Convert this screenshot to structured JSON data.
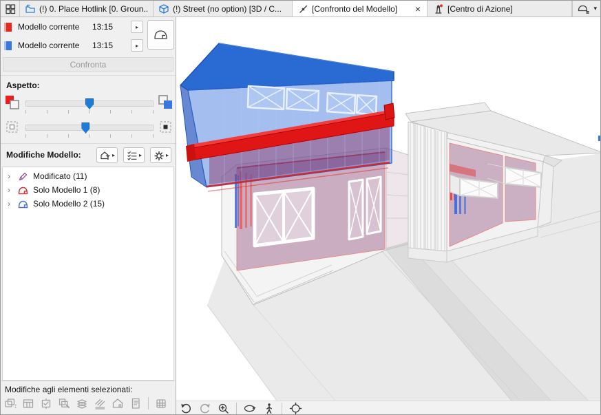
{
  "tab_bar": {
    "overview_button": {
      "icon": "tab-overview-icon"
    },
    "tabs": [
      {
        "label": "(!) 0. Place Hotlink [0. Groun...",
        "icon": "hotlink-folder-icon",
        "active": false
      },
      {
        "label": "(!) Street (no option) [3D / C...",
        "icon": "3d-cube-icon",
        "active": false
      },
      {
        "label": "[Confronto del Modello]",
        "icon": "model-compare-icon",
        "active": true,
        "close_glyph": "×"
      },
      {
        "label": "[Centro di Azione]",
        "icon": "action-center-icon",
        "active": false,
        "has_notification": true
      }
    ],
    "corner_button": {
      "icon": "model-list-icon",
      "dropdown_glyph": "▾"
    }
  },
  "compare_panel": {
    "model_rows": [
      {
        "label": "Modello corrente",
        "time": "13:15",
        "swatch_color": "#e8281e",
        "menu_glyph": "▸"
      },
      {
        "label": "Modello corrente",
        "time": "13:15",
        "swatch_color": "#3a78e0",
        "menu_glyph": "▸"
      }
    ],
    "show_button_icon": "model-dome-icon",
    "compare_button_label": "Confronta",
    "appearance": {
      "label": "Aspetto:",
      "color_slider": {
        "percent": 50
      },
      "opacity_slider": {
        "percent": 47
      }
    },
    "model_changes": {
      "label": "Modifiche Modello:",
      "toolbar_icons": [
        "filter-elements-icon",
        "criteria-list-icon",
        "settings-gear-icon"
      ],
      "menu_glyph": "▸",
      "expander_glyph": "›",
      "tree_items": [
        {
          "label": "Modificato (11)",
          "icon": "pencil-icon",
          "icon_color": "#9b4f96"
        },
        {
          "label": "Solo Modello 1 (8)",
          "icon": "house-model1-icon",
          "icon_color": "#cf3b3b"
        },
        {
          "label": "Solo Modello 2 (15)",
          "icon": "house-model2-icon",
          "icon_color": "#4a78d0"
        }
      ]
    },
    "footer": {
      "label": "Modifiche agli elementi selezionati:",
      "icons": [
        "change-id-icon",
        "schedule-icon",
        "marker-check-icon",
        "transfer-parameters-icon",
        "layers-icon",
        "fills-icon",
        "building-icon",
        "report-icon",
        "table-grid-icon"
      ]
    }
  },
  "viewport": {
    "toolbar_icons": [
      "undo-view-icon",
      "redo-view-icon",
      "zoom-in-icon",
      "orbit-icon",
      "explore-walk-icon",
      "fit-in-window-icon"
    ],
    "colors": {
      "model1_red": "#e01616",
      "model2_blue": "#2a6ad3",
      "modified_fill": "#c59fb8",
      "ground_gray": "#eaeaea",
      "wireframe_gray": "#c2c2c2"
    }
  }
}
